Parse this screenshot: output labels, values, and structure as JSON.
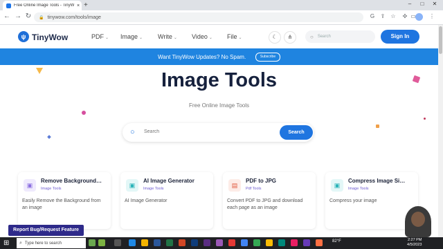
{
  "browser": {
    "tab_title": "Free Online Image Tools - TinyW",
    "tab_close": "×",
    "new_tab": "+",
    "url": "tinywow.com/tools/image",
    "window_controls": [
      "–",
      "□",
      "✕"
    ]
  },
  "site": {
    "logo_mark": "ψ",
    "logo_text": "TinyWow",
    "menu": [
      {
        "label": "PDF"
      },
      {
        "label": "Image"
      },
      {
        "label": "Write"
      },
      {
        "label": "Video"
      },
      {
        "label": "File"
      }
    ],
    "search_placeholder": "Search",
    "signin_label": "Sign In"
  },
  "banner": {
    "text": "Want TinyWow Updates? No Spam.",
    "button": "Subscribe"
  },
  "hero": {
    "title": "Image Tools",
    "subtitle": "Free Online Image Tools",
    "search_placeholder": "Search",
    "search_button": "Search"
  },
  "cards": [
    {
      "title": "Remove Background…",
      "category": "Image Tools",
      "description": "Easily Remove the Background from an image",
      "icon": "image-icon",
      "accent": "#8b6fe0",
      "icon_bg": "#efeafd"
    },
    {
      "title": "AI Image Generator",
      "category": "Image Tools",
      "description": "AI Image Generator",
      "icon": "image-icon",
      "accent": "#2ab3b8",
      "icon_bg": "#e3f7f7"
    },
    {
      "title": "PDF to JPG",
      "category": "Pdf Tools",
      "description": "Convert PDF to JPG and download each page as an image",
      "icon": "pdf-icon",
      "accent": "#e0583e",
      "icon_bg": "#fdece7"
    },
    {
      "title": "Compress Image Si…",
      "category": "Image Tools",
      "description": "Compress your image",
      "icon": "image-icon",
      "accent": "#2ab3b8",
      "icon_bg": "#e3f7f7"
    }
  ],
  "report_button": "Report Bug/Request Feature",
  "taskbar": {
    "search_placeholder": "Type here to search",
    "weather": "82°F",
    "clock_time": "2:27 PM",
    "clock_date": "4/5/2023"
  },
  "colors": {
    "brand": "#1f75e0",
    "banner": "#1f84e0",
    "title": "#16213d"
  }
}
